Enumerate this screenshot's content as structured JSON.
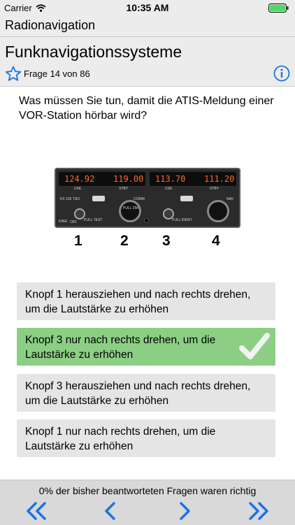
{
  "status": {
    "carrier": "Carrier",
    "time": "10:35 AM"
  },
  "nav": {
    "title": "Radionavigation"
  },
  "header": {
    "section_title": "Funknavigationssysteme",
    "counter": "Frage 14 von 86"
  },
  "question": "Was müssen Sie tun, damit die ATIS-Meldung einer VOR-Station hörbar wird?",
  "radio": {
    "comm_use": "124.92",
    "comm_stby": "119.00",
    "nav_use": "113.70",
    "nav_stby": "111.20",
    "label_use": "USE",
    "label_stby": "STBY",
    "label_comm": "COMM",
    "label_nav": "NAV",
    "label_model": "KX 155 TSO",
    "label_king": "KING",
    "label_off": "OFF",
    "label_pull_test": "PULL TEST",
    "label_pull_ident": "PULL IDENT",
    "label_pull_25k": "PULL 25K",
    "knob_numbers": [
      "1",
      "2",
      "3",
      "4"
    ]
  },
  "answers": [
    {
      "text": "Knopf 1 herausziehen und nach rechts drehen, um die Lautstärke zu erhöhen",
      "correct": false
    },
    {
      "text": "Knopf 3 nur nach rechts drehen, um die Lautstärke zu erhöhen",
      "correct": true
    },
    {
      "text": "Knopf 3 herausziehen und nach rechts drehen, um die Lautstärke zu erhöhen",
      "correct": false
    },
    {
      "text": "Knopf 1 nur nach rechts drehen, um die Lautstärke zu erhöhen",
      "correct": false
    }
  ],
  "footer": {
    "progress_text": "0% der bisher beantworteten Fragen waren richtig"
  },
  "icons": {
    "wifi": "wifi-icon",
    "battery": "battery-icon",
    "star": "star-icon",
    "info": "info-icon",
    "check": "checkmark-icon",
    "first": "double-chevron-left-icon",
    "prev": "chevron-left-icon",
    "next": "chevron-right-icon",
    "last": "double-chevron-right-icon"
  },
  "colors": {
    "accent": "#1a73e8",
    "correct": "#8ccf84",
    "answer_bg": "#e5e5e5",
    "display_text": "#ff6a2a"
  }
}
